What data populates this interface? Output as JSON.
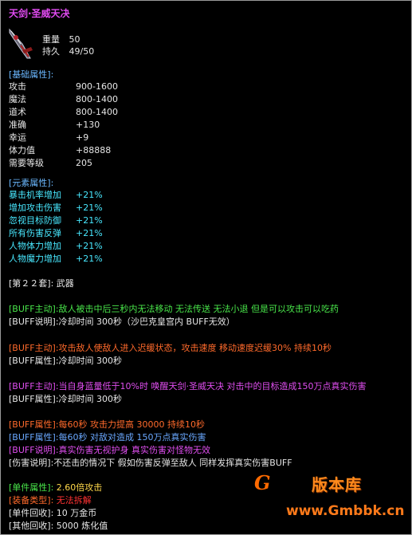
{
  "item": {
    "title": "天剑·圣威天决",
    "weight_label": "重量",
    "weight_value": "50",
    "durability_label": "持久",
    "durability_value": "49/50"
  },
  "basic": {
    "header": "[基础属性]:",
    "stats": [
      {
        "label": "攻击",
        "value": "900-1600"
      },
      {
        "label": "魔法",
        "value": "800-1400"
      },
      {
        "label": "道术",
        "value": "800-1400"
      },
      {
        "label": "准确",
        "value": "+130"
      },
      {
        "label": "幸运",
        "value": "+9"
      },
      {
        "label": "体力值",
        "value": "+88888"
      },
      {
        "label": "需要等级",
        "value": "205"
      }
    ]
  },
  "element": {
    "header": "[元素属性]:",
    "stats": [
      {
        "label": "暴击机率增加",
        "value": "+21%"
      },
      {
        "label": "增加攻击伤害",
        "value": "+21%"
      },
      {
        "label": "忽视目标防御",
        "value": "+21%"
      },
      {
        "label": "所有伤害反弹",
        "value": "+21%"
      },
      {
        "label": "人物体力增加",
        "value": "+21%"
      },
      {
        "label": "人物魔力增加",
        "value": "+21%"
      }
    ]
  },
  "set": {
    "label": "[第２２套]:",
    "value": "武器"
  },
  "buffs": [
    {
      "a_label": "[BUFF主动]:",
      "a_text": "敌人被击中后三秒内无法移动 无法传送 无法小退 但是可以攻击可以吃药",
      "b_label": "[BUFF说明]:",
      "b_text": "冷却时间 300秒（沙巴克皇宫内 BUFF无效）"
    },
    {
      "a_label": "[BUFF主动]:",
      "a_text": "攻击敌人使敌人进入迟缓状态，攻击速度 移动速度迟缓30% 持续10秒",
      "b_label": "[BUFF属性]:",
      "b_text": "冷却时间 300秒"
    },
    {
      "a_label": "[BUFF主动]:",
      "a_text": "当自身蓝量低于10%时 唤醒天剑·圣威天决 对击中的目标造成150万点真实伤害",
      "b_label": "[BUFF属性]:",
      "b_text": "冷却时间 300秒"
    }
  ],
  "extra": [
    {
      "label": "[BUFF属性]:",
      "text": "每60秒 攻击力提高 30000 持续10秒"
    },
    {
      "label": "[BUFF属性]:",
      "text": "每60秒 对敌对造成 150万点真实伤害"
    },
    {
      "label": "[BUFF说明]:",
      "text": "真实伤害无视护身 真实伤害对怪物无效"
    },
    {
      "label": "[伤害说明]:",
      "text": "不还击的情况下 假如伤害反弹至敌人 同样发挥真实伤害BUFF"
    }
  ],
  "footer": [
    {
      "label": "[单件属性]:",
      "text": "2.60倍攻击"
    },
    {
      "label": "[装备类型]:",
      "text": "无法拆解"
    },
    {
      "label": "[单件回收]:",
      "text": "10 万金币"
    },
    {
      "label": "[其他回收]:",
      "text": "5000 炼化值"
    }
  ],
  "watermark": {
    "brand": "版本库",
    "letter": "G",
    "site": "www.Gmbbk.cn"
  }
}
